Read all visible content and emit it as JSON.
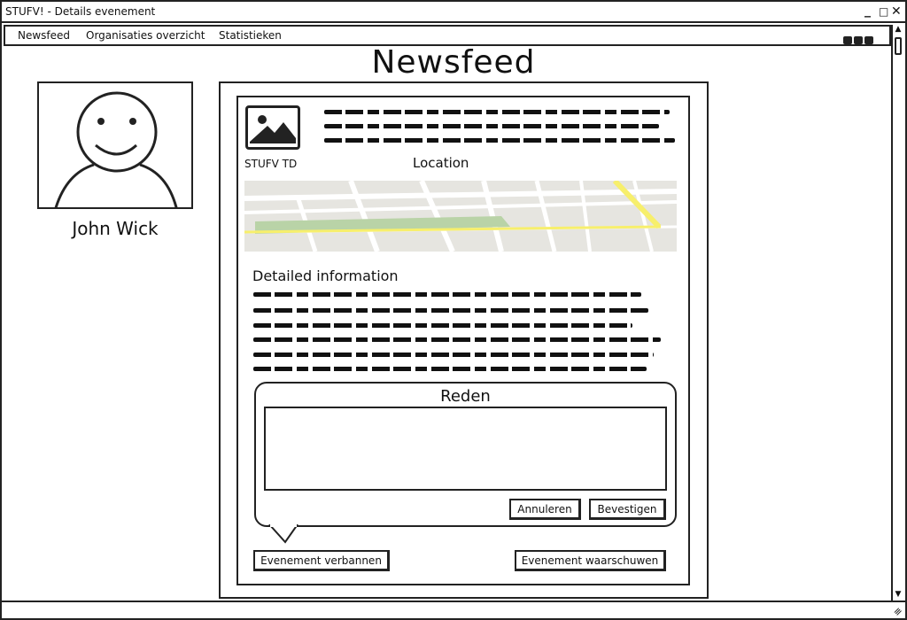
{
  "window": {
    "title": "STUFV! - Details evenement",
    "controls": [
      "_",
      "□",
      "✕"
    ]
  },
  "menu": {
    "items": [
      "Newsfeed",
      "Organisaties overzicht",
      "Statistieken"
    ]
  },
  "page": {
    "heading": "Newsfeed"
  },
  "profile": {
    "name": "John Wick",
    "avatar_icon": "person-avatar-icon"
  },
  "event": {
    "image_icon": "image-placeholder-icon",
    "organisation": "STUFV TD",
    "location_label": "Location",
    "detail_label": "Detailed information"
  },
  "reason_dialog": {
    "label": "Reden",
    "input_value": "",
    "cancel_label": "Annuleren",
    "confirm_label": "Bevestigen"
  },
  "actions": {
    "ban_label": "Evenement verbannen",
    "warn_label": "Evenement waarschuwen"
  },
  "colors": {
    "map_background": "#e6e5e0",
    "map_park": "#b9d3a7",
    "map_highway": "#f7ef6c"
  }
}
